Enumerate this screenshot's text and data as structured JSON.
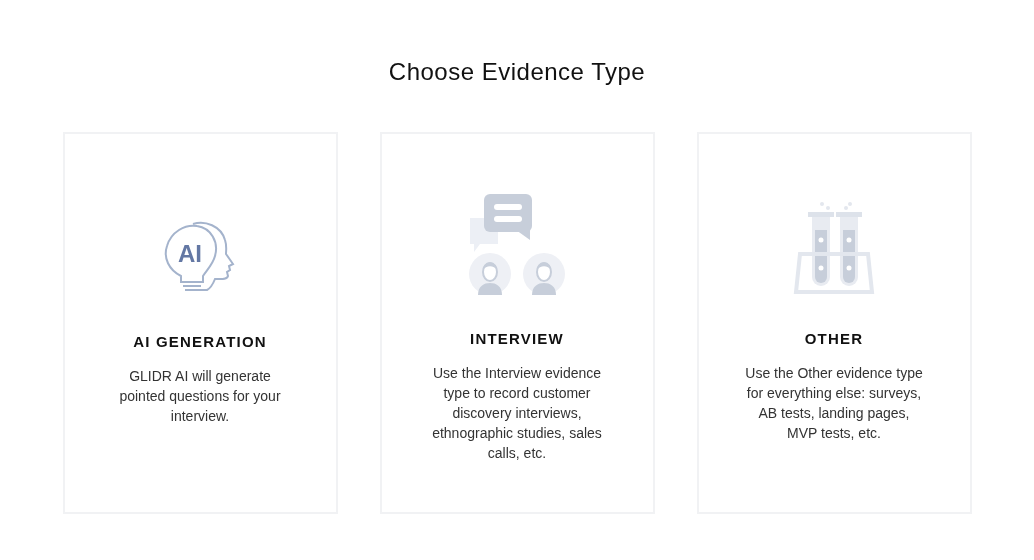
{
  "title": "Choose Evidence Type",
  "cards": [
    {
      "kind": "ai",
      "icon_text": "AI",
      "heading": "AI GENERATION",
      "description": "GLIDR AI will generate pointed questions for your interview."
    },
    {
      "kind": "interview",
      "heading": "INTERVIEW",
      "description": "Use the Interview evidence type to record customer discovery interviews, ethnographic studies, sales calls, etc."
    },
    {
      "kind": "lab",
      "heading": "OTHER",
      "description": "Use the Other evidence type for everything else: surveys, AB tests, landing pages, MVP tests, etc."
    }
  ]
}
